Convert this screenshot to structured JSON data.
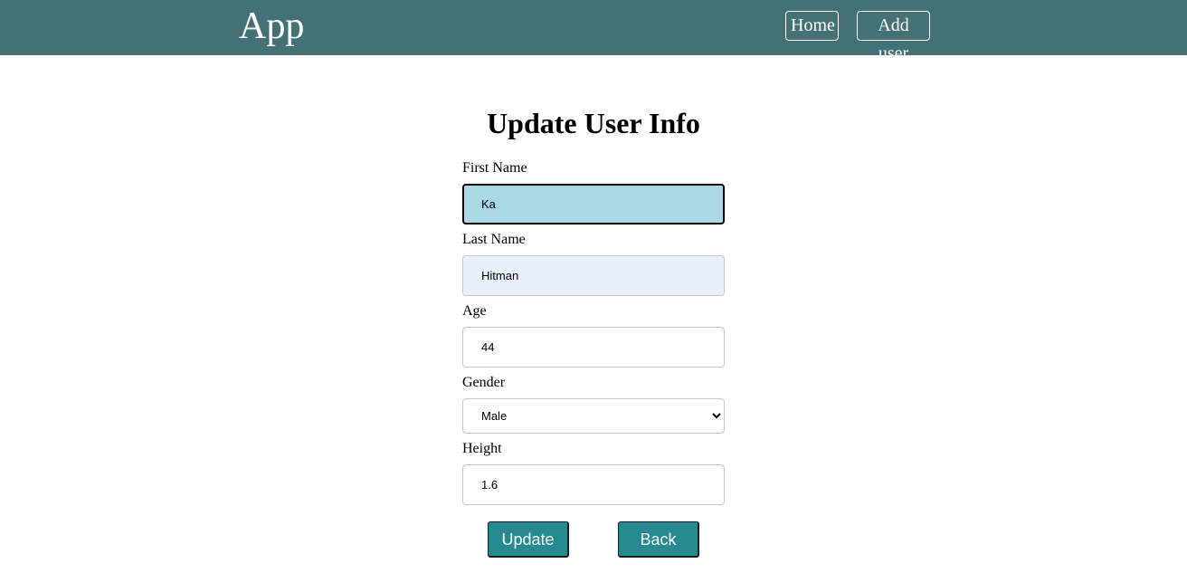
{
  "navbar": {
    "brand": "App",
    "links": [
      {
        "label": "Home"
      },
      {
        "label": "Add user"
      }
    ]
  },
  "form": {
    "title": "Update User Info",
    "first_name": {
      "label": "First Name",
      "value": "Ka"
    },
    "last_name": {
      "label": "Last Name",
      "value": "Hitman"
    },
    "age": {
      "label": "Age",
      "value": "44"
    },
    "gender": {
      "label": "Gender",
      "value": "Male"
    },
    "height": {
      "label": "Height",
      "value": "1.6"
    },
    "update_label": "Update",
    "back_label": "Back"
  },
  "colors": {
    "navbar": "#437176",
    "button": "#268a91",
    "focused_field": "#aad8e6",
    "autofill_field": "#e8effd"
  }
}
